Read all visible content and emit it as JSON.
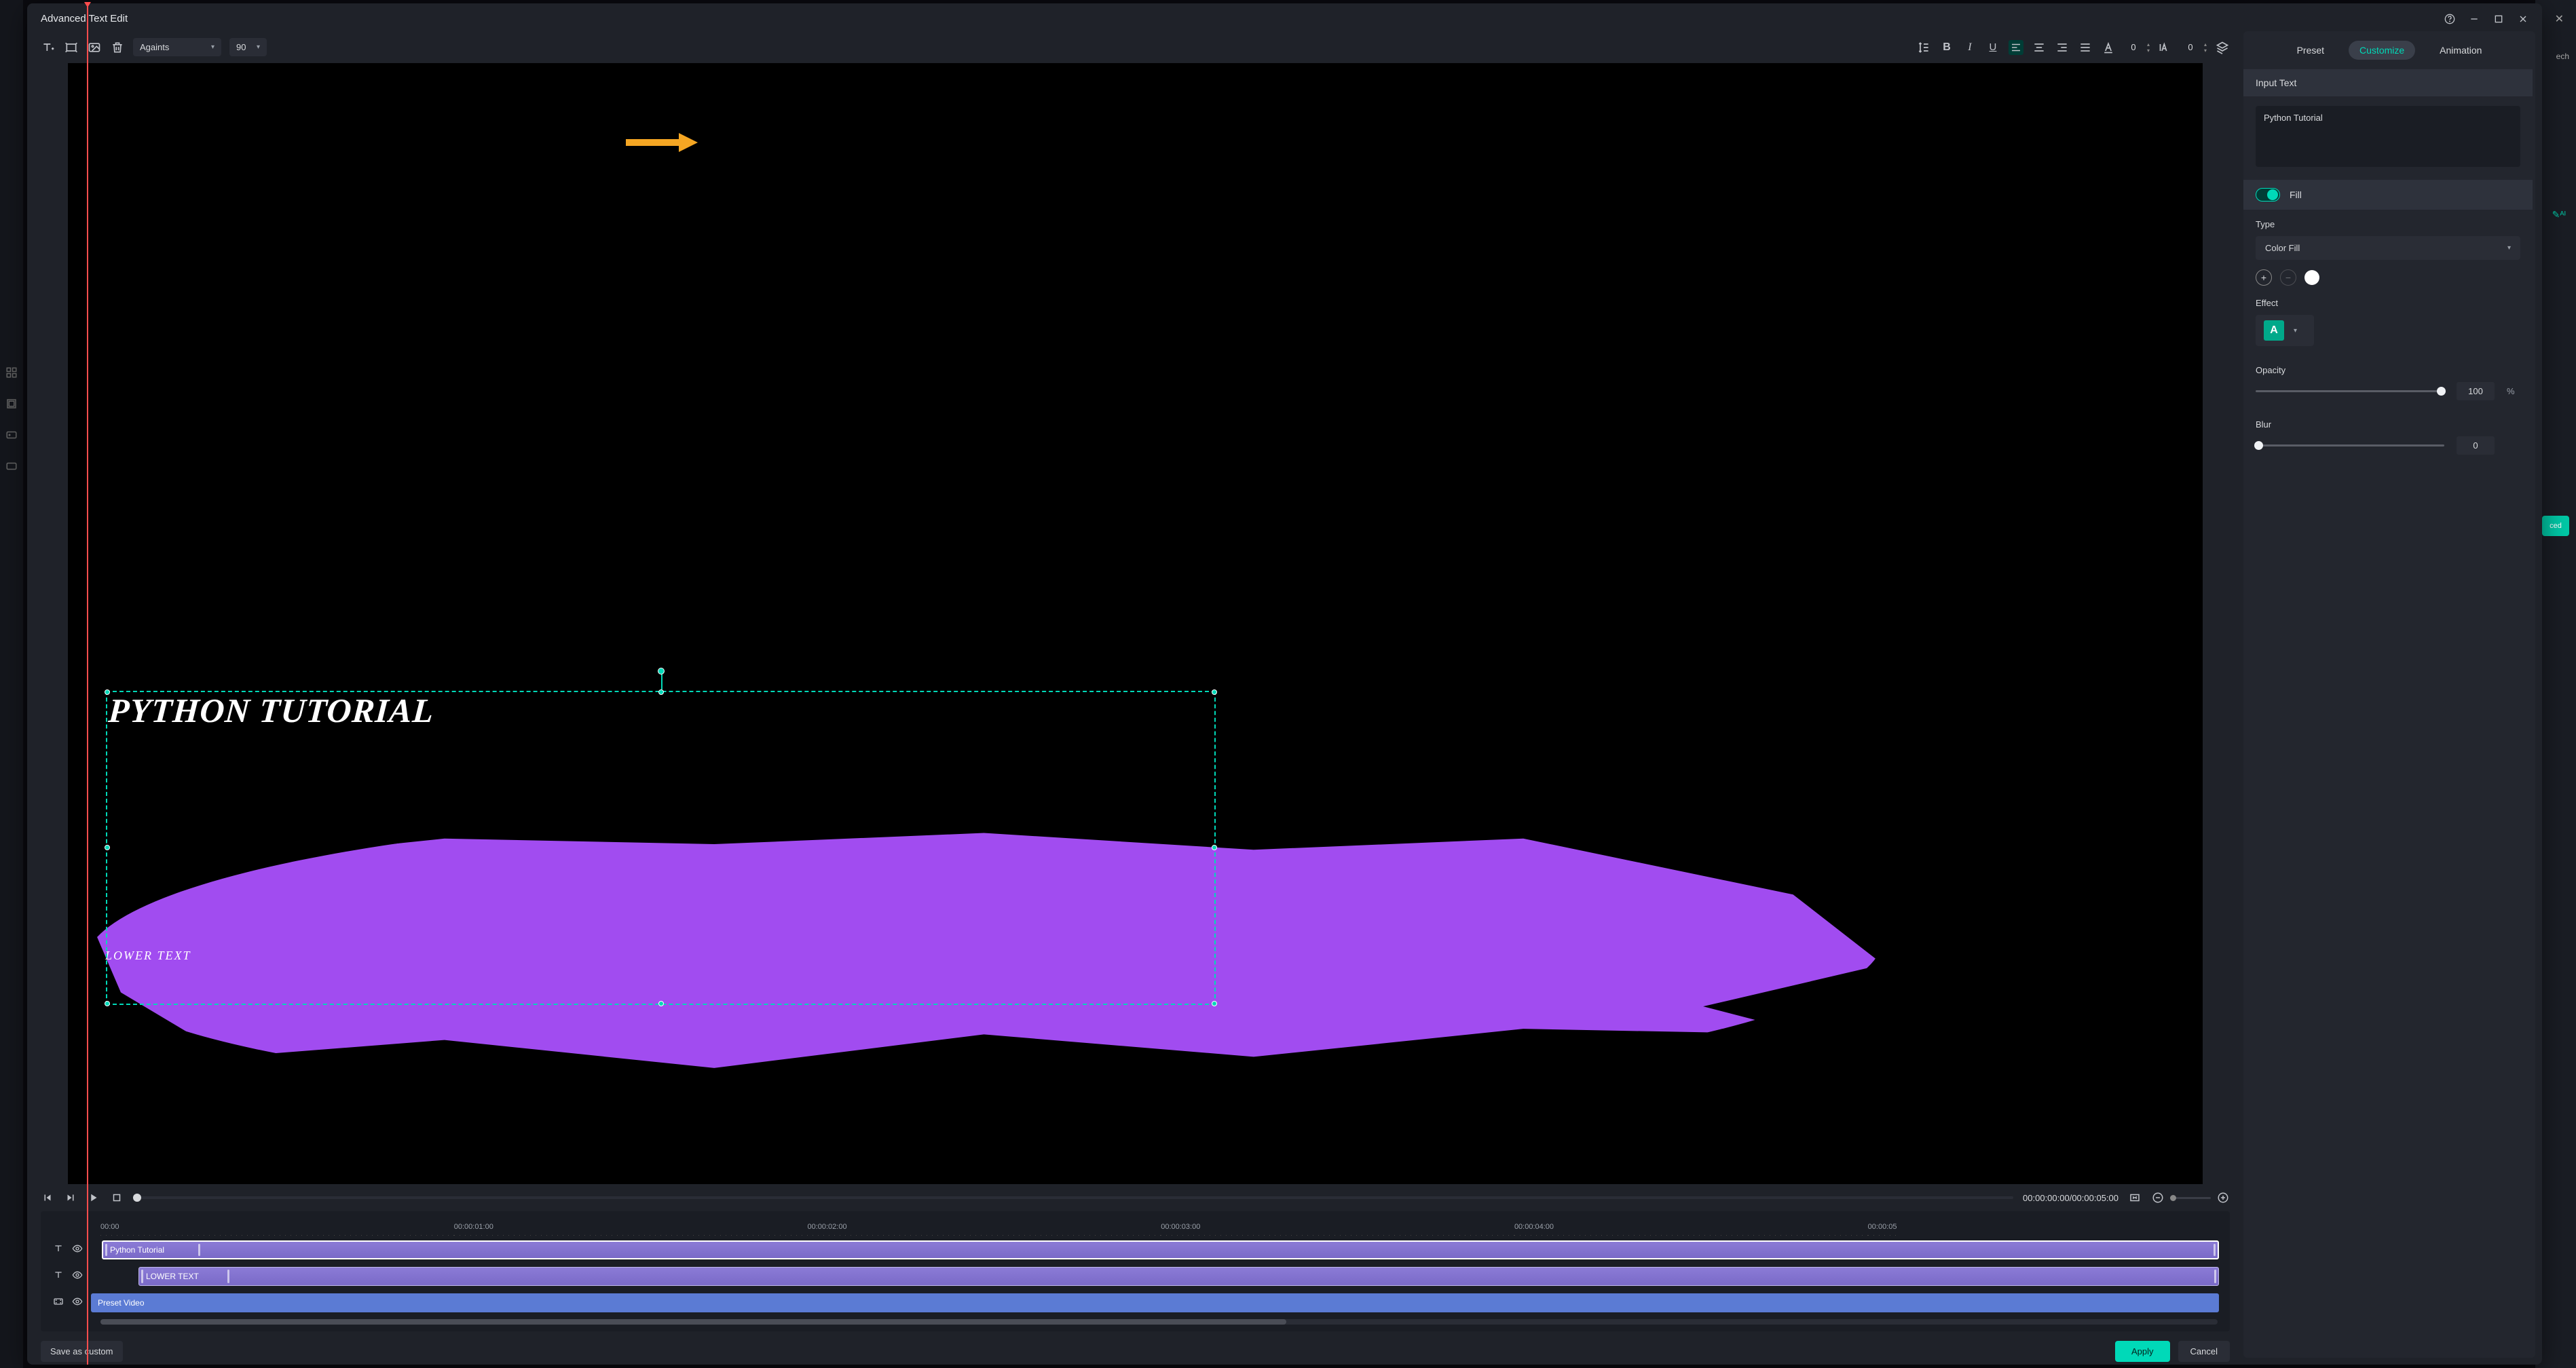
{
  "app": {
    "title": "Advanced Text Edit",
    "behindText": "ech",
    "behindBtn": "ced"
  },
  "toolbar": {
    "font": "Againts",
    "fontSize": "90",
    "spacing": "0",
    "tracking": "0"
  },
  "preview": {
    "mainText": "PYTHON TUTORIAL",
    "lowerText": "LOWER TEXT"
  },
  "playbar": {
    "timecode": "00:00:00:00/00:00:05:00"
  },
  "timeline": {
    "marks": [
      "00:00",
      "00:00:01:00",
      "00:00:02:00",
      "00:00:03:00",
      "00:00:04:00",
      "00:00:05"
    ],
    "tracks": [
      {
        "label": "Python Tutorial",
        "start": 2
      },
      {
        "label": "LOWER TEXT",
        "start": 9
      },
      {
        "label": "Preset Video",
        "start": 0
      }
    ]
  },
  "rightPanel": {
    "tabs": {
      "preset": "Preset",
      "customize": "Customize",
      "animation": "Animation"
    },
    "inputTextHeader": "Input Text",
    "textValue": "Python Tutorial",
    "fillLabel": "Fill",
    "typeLabel": "Type",
    "typeValue": "Color Fill",
    "effectLabel": "Effect",
    "effectIcon": "A",
    "opacityLabel": "Opacity",
    "opacityValue": "100",
    "opacityUnit": "%",
    "blurLabel": "Blur",
    "blurValue": "0"
  },
  "footer": {
    "save": "Save as custom",
    "apply": "Apply",
    "cancel": "Cancel"
  }
}
